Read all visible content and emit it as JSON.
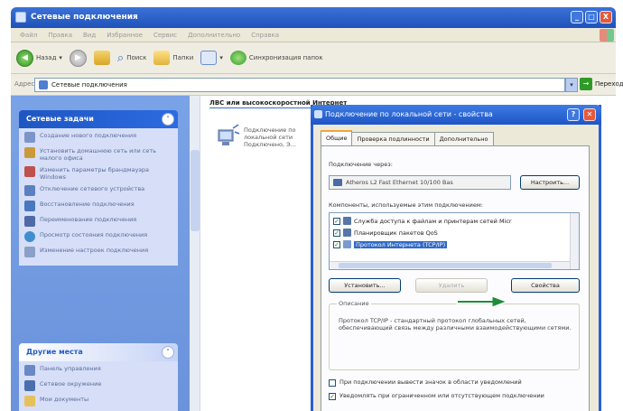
{
  "window": {
    "title": "Сетевые подключения",
    "min": "_",
    "max": "□",
    "close": "X"
  },
  "menu": [
    "Файл",
    "Правка",
    "Вид",
    "Избранное",
    "Сервис",
    "Дополнительно",
    "Справка"
  ],
  "toolbar": {
    "back": "Назад",
    "forward": "",
    "search": "Поиск",
    "folders": "Папки",
    "sync": "Синхронизация папок"
  },
  "address": {
    "label": "Адрес:",
    "value": "Сетевые подключения",
    "go": "Переход"
  },
  "tasks": {
    "network": {
      "title": "Сетевые задачи",
      "items": [
        "Создание нового подключения",
        "Установить домашнюю сеть или сеть малого офиса",
        "Изменить параметры брандмауэра Windows",
        "Отключение сетевого устройства",
        "Восстановление подключения",
        "Переименование подключения",
        "Просмотр состояния подключения",
        "Изменение настроек подключения"
      ]
    },
    "other": {
      "title": "Другие места",
      "items": [
        "Панель управления",
        "Сетевое окружение",
        "Мои документы"
      ]
    }
  },
  "content": {
    "group": "ЛВС или высокоскоростной Интернет",
    "connection": "Подключение по локальной сети Подключено, Э..."
  },
  "dialog": {
    "title": "Подключение по локальной сети - свойства",
    "tabs": [
      "Общие",
      "Проверка подлинности",
      "Дополнительно"
    ],
    "connect_label": "Подключение через:",
    "adapter": "Atheros L2 Fast Ethernet 10/100 Bas",
    "configure": "Настроить...",
    "components_label": "Компоненты, используемые этим подключением:",
    "components": [
      {
        "label": "Служба доступа к файлам и принтерам сетей Micr",
        "checked": "✓"
      },
      {
        "label": "Планировщик пакетов QoS",
        "checked": "✓"
      },
      {
        "label": "Протокол Интернета (TCP/IP)",
        "checked": "✓"
      }
    ],
    "install": "Установить...",
    "uninstall": "Удалить",
    "properties": "Свойства",
    "description_legend": "Описание",
    "description": "Протокол TCP/IP - стандартный протокол глобальных сетей, обеспечивающий связь между различными взаимодействующими сетями.",
    "option1": "При подключении вывести значок в области уведомлений",
    "option2": "Уведомлять при ограниченном или отсутствующем подключении",
    "option2_checked": "✓"
  },
  "colors": {
    "title_blue": "#1f52b8",
    "task_bg": "#6b93dc",
    "dialog_face": "#ece9d8",
    "selection": "#316ac5"
  }
}
